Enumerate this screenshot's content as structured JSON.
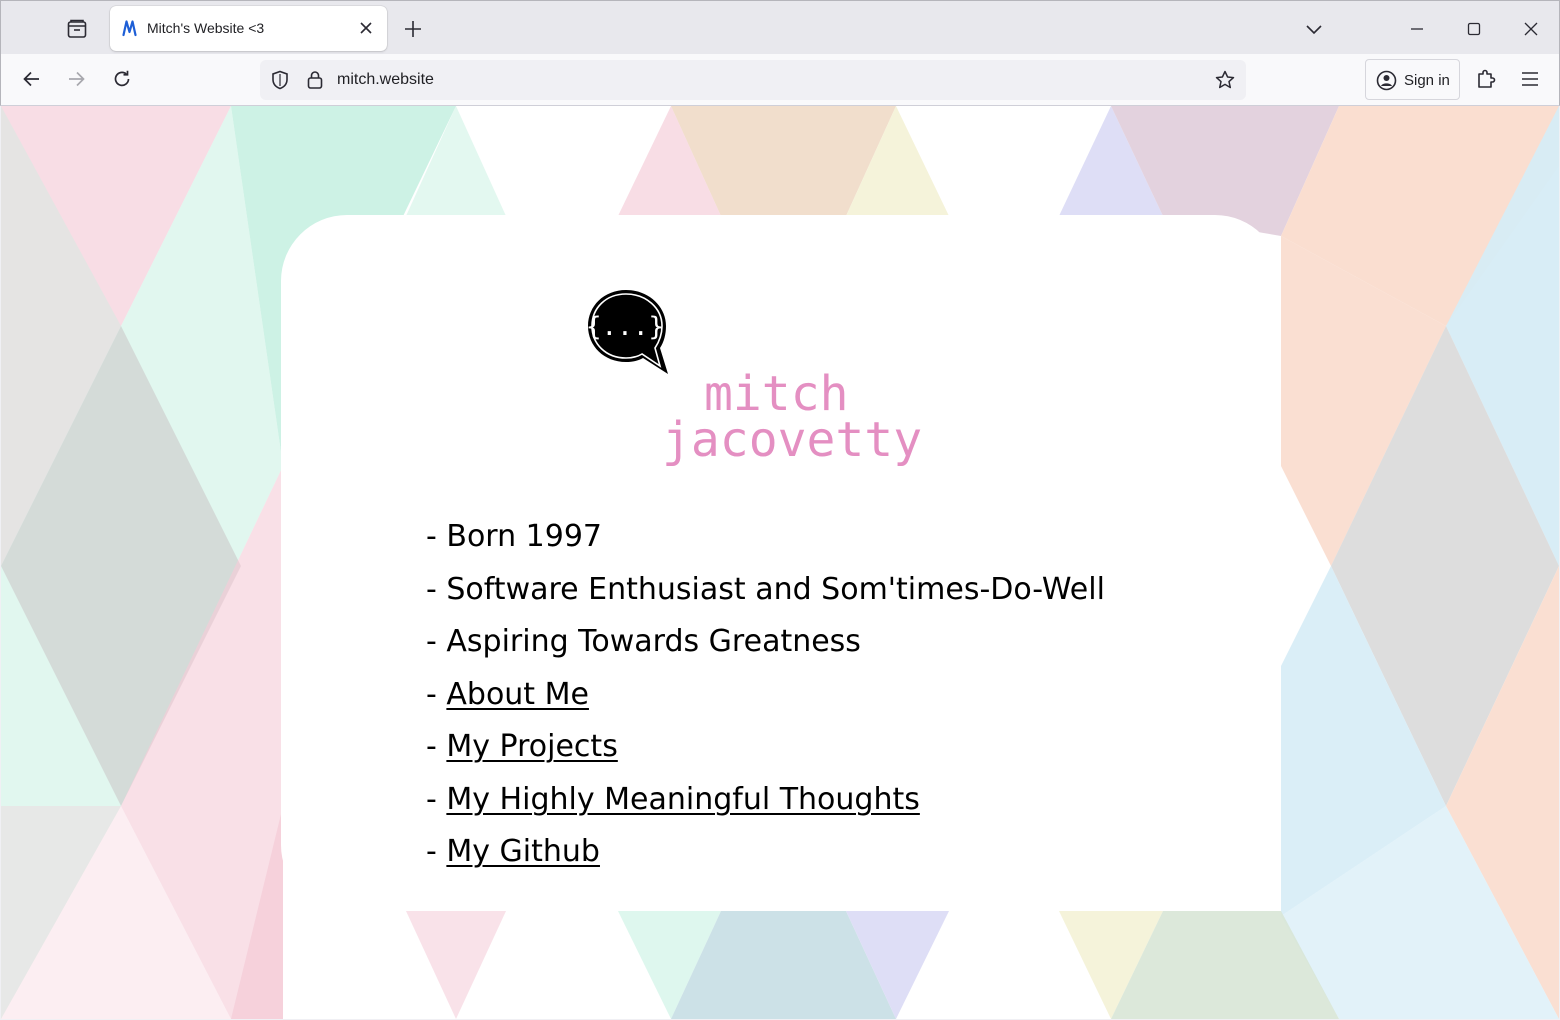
{
  "browser": {
    "tab": {
      "title": "Mitch's Website <3"
    },
    "url": "mitch.website",
    "sign_in_label": "Sign in"
  },
  "page": {
    "logo": {
      "glyph": "{...}",
      "first_name": "mitch",
      "last_name": "jacovetty"
    },
    "facts": [
      {
        "prefix": "- ",
        "text": "Born 1997"
      },
      {
        "prefix": "- ",
        "text": "Software Enthusiast and Som'times-Do-Well"
      },
      {
        "prefix": "- ",
        "text": "Aspiring Towards Greatness"
      }
    ],
    "links": [
      {
        "prefix": "- ",
        "text": "About Me"
      },
      {
        "prefix": "- ",
        "text": "My Projects"
      },
      {
        "prefix": "- ",
        "text": "My Highly Meaningful Thoughts"
      },
      {
        "prefix": "- ",
        "text": "My Github"
      }
    ]
  },
  "theme": {
    "accent_pink": "#e48fc2",
    "pastels": [
      "#f4c6d4",
      "#c8f1e2",
      "#f0dcc9",
      "#f4f2d8",
      "#dcdcf6",
      "#e2d0dc",
      "#fadccd",
      "#d6ecf6",
      "#cfcfcf"
    ]
  }
}
